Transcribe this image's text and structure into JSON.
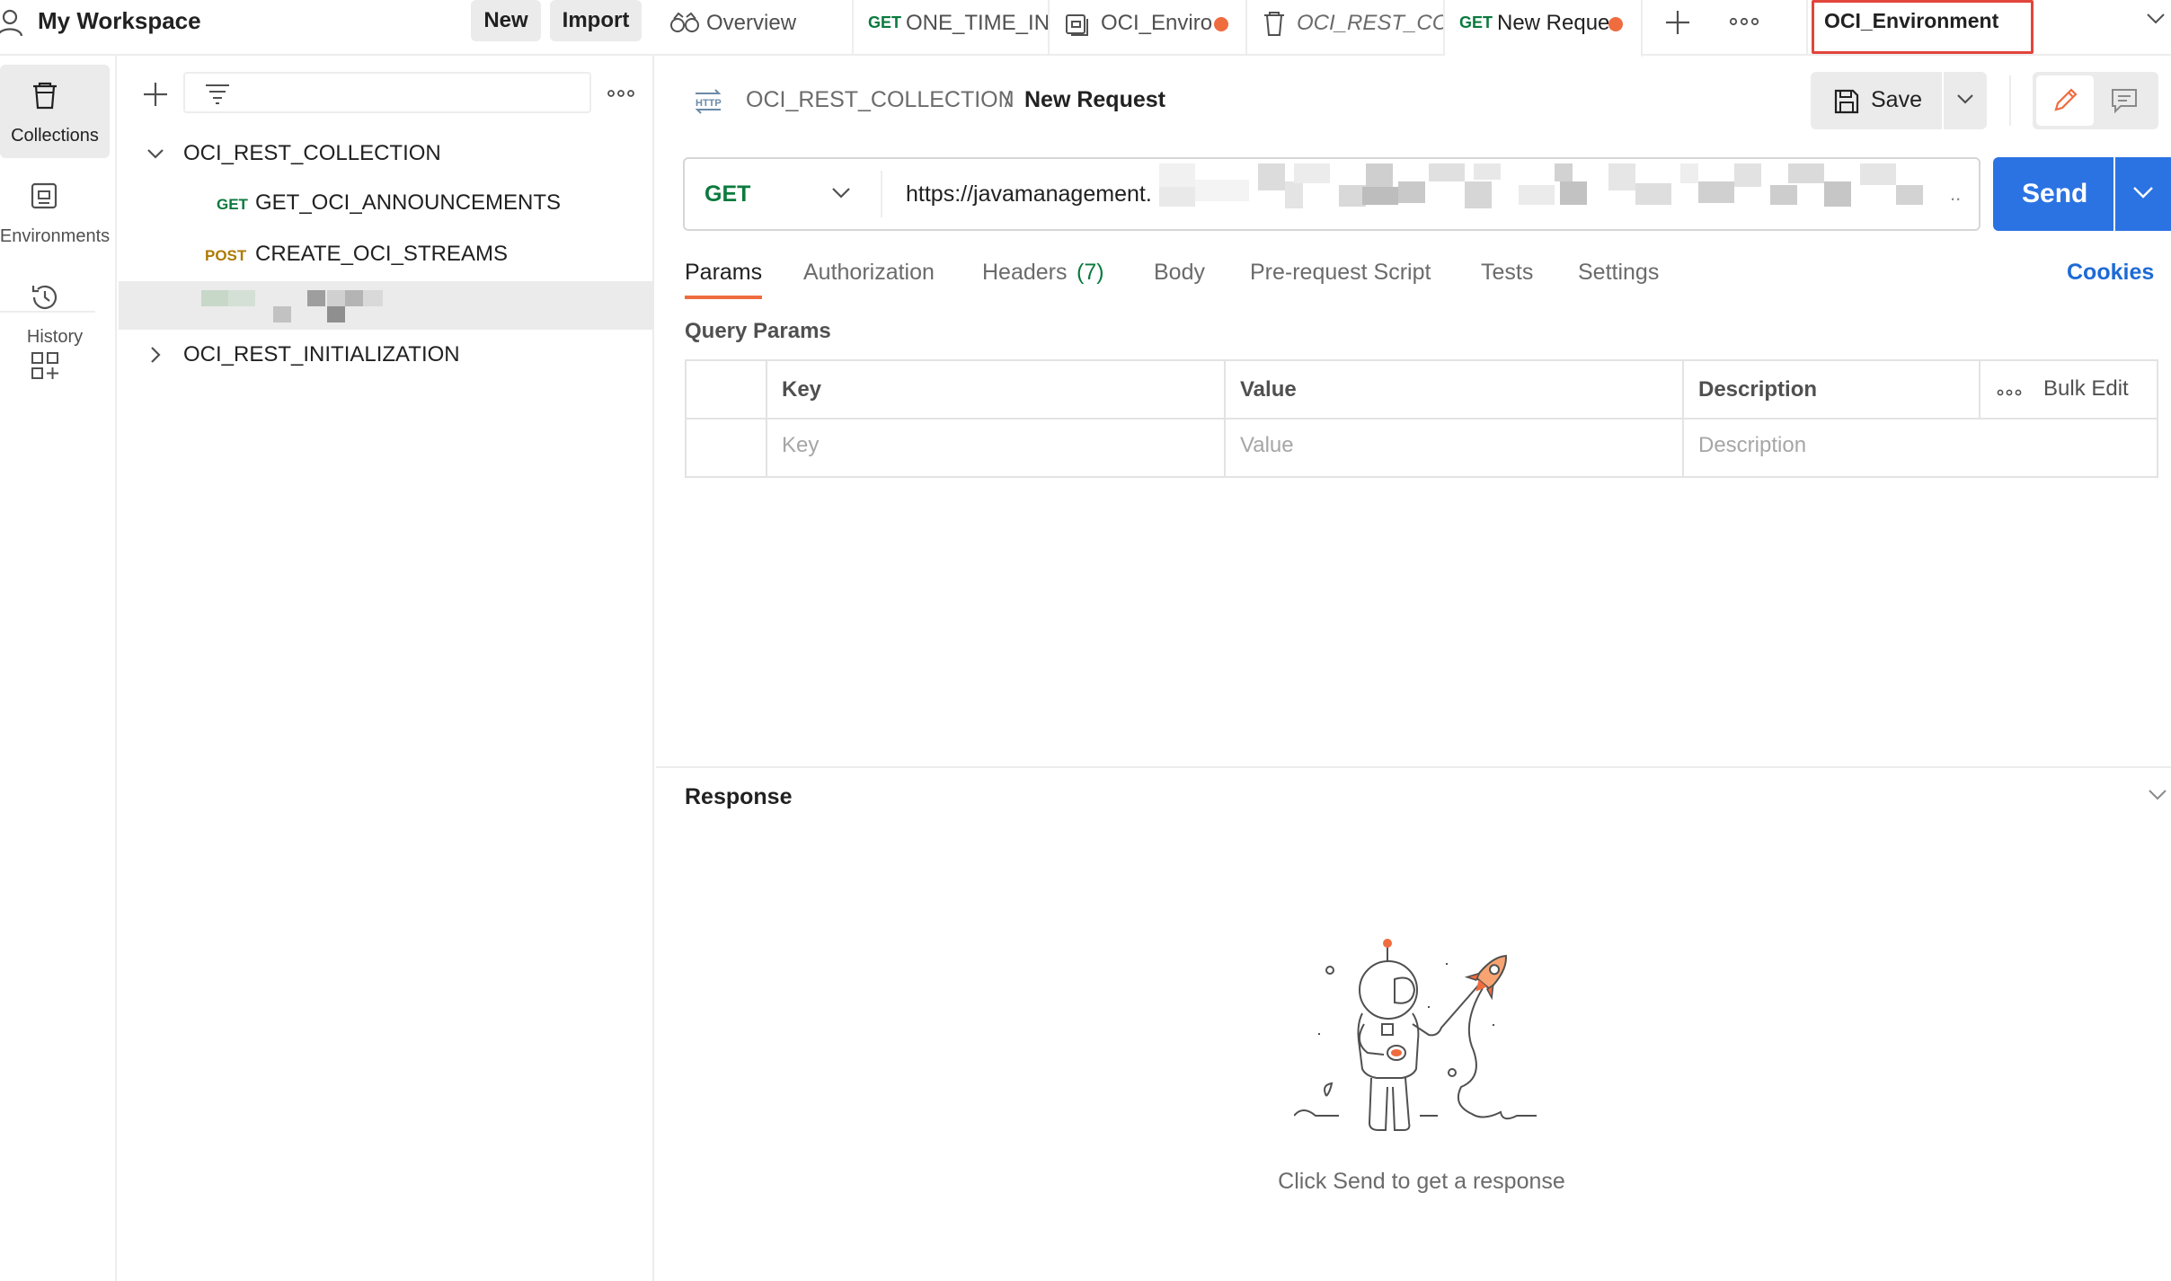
{
  "workspace": {
    "name": "My Workspace",
    "new_label": "New",
    "import_label": "Import"
  },
  "tabs": [
    {
      "label": "Overview",
      "method": "",
      "unsaved": false
    },
    {
      "label": "ONE_TIME_IN",
      "method": "GET",
      "unsaved": false
    },
    {
      "label": "OCI_Enviro",
      "method": "",
      "unsaved": true
    },
    {
      "label": "OCI_REST_CC",
      "method": "",
      "unsaved": false
    },
    {
      "label": "New Reque",
      "method": "GET",
      "unsaved": true
    }
  ],
  "environment": {
    "selected": "OCI_Environment"
  },
  "leftnav": {
    "items": [
      {
        "label": "Collections",
        "icon": "trash-can-icon"
      },
      {
        "label": "Environments",
        "icon": "environment-icon"
      },
      {
        "label": "History",
        "icon": "history-icon"
      }
    ],
    "apps_icon": "add-apps-icon"
  },
  "sidebar": {
    "collections": [
      {
        "name": "OCI_REST_COLLECTION",
        "expanded": true,
        "requests": [
          {
            "method": "GET",
            "name": "GET_OCI_ANNOUNCEMENTS"
          },
          {
            "method": "POST",
            "name": "CREATE_OCI_STREAMS"
          }
        ]
      },
      {
        "name": "OCI_REST_INITIALIZATION",
        "expanded": false
      }
    ]
  },
  "request": {
    "breadcrumb_collection": "OCI_REST_COLLECTION",
    "breadcrumb_separator": "/",
    "name": "New Request",
    "save_label": "Save",
    "method": "GET",
    "url": "https://javamanagement.",
    "url_ellipsis": "..",
    "send_label": "Send",
    "tabs": {
      "params": "Params",
      "authorization": "Authorization",
      "headers": "Headers",
      "headers_count": "(7)",
      "body": "Body",
      "prerequest": "Pre-request Script",
      "tests": "Tests",
      "settings": "Settings",
      "cookies": "Cookies"
    },
    "query_params": {
      "title": "Query Params",
      "columns": [
        "Key",
        "Value",
        "Description"
      ],
      "placeholders": [
        "Key",
        "Value",
        "Description"
      ],
      "bulk_edit": "Bulk Edit"
    }
  },
  "response": {
    "title": "Response",
    "hint": "Click Send to get a response"
  },
  "colors": {
    "accent_orange": "#ef6c3f",
    "send_blue": "#2b73e3",
    "get_green": "#0b7a3e",
    "post_amber": "#ad7a03",
    "highlight_red": "#e2453c"
  }
}
